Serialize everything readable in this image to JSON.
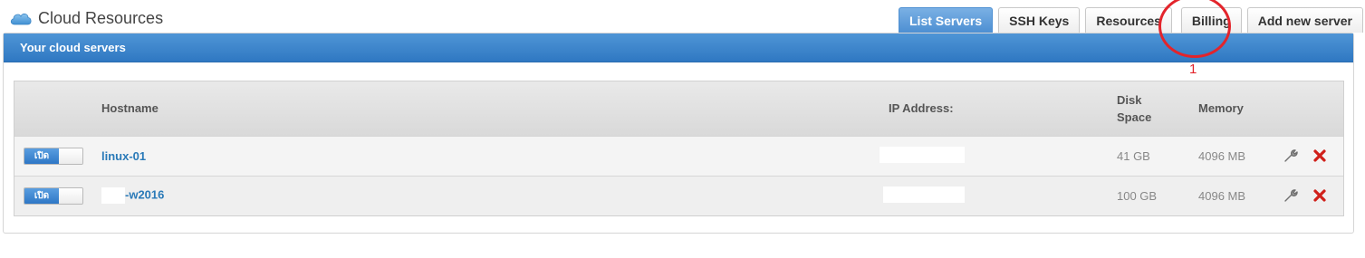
{
  "app": {
    "title": "Cloud Resources",
    "icon": "cloud-icon"
  },
  "tabs": [
    {
      "label": "List Servers",
      "active": true
    },
    {
      "label": "SSH Keys",
      "active": false
    },
    {
      "label": "Resources",
      "active": false
    },
    {
      "label": "Billing",
      "active": false
    },
    {
      "label": "Add new server",
      "active": false
    }
  ],
  "annotation": {
    "number": "1",
    "color": "#e3242b"
  },
  "panel": {
    "title": "Your cloud servers"
  },
  "table": {
    "headers": {
      "hostname": "Hostname",
      "ip": "IP Address:",
      "disk_line1": "Disk",
      "disk_line2": "Space",
      "memory": "Memory"
    },
    "rows": [
      {
        "toggle_label": "เปิด",
        "hostname": "linux-01",
        "hostname_prefix_redacted": false,
        "disk": "41 GB",
        "memory": "4096 MB"
      },
      {
        "toggle_label": "เปิด",
        "hostname": "-w2016",
        "hostname_prefix_redacted": true,
        "disk": "100 GB",
        "memory": "4096 MB"
      }
    ]
  },
  "colors": {
    "accent": "#3b86cc",
    "link": "#2a7ab8",
    "delete": "#d0201a"
  }
}
